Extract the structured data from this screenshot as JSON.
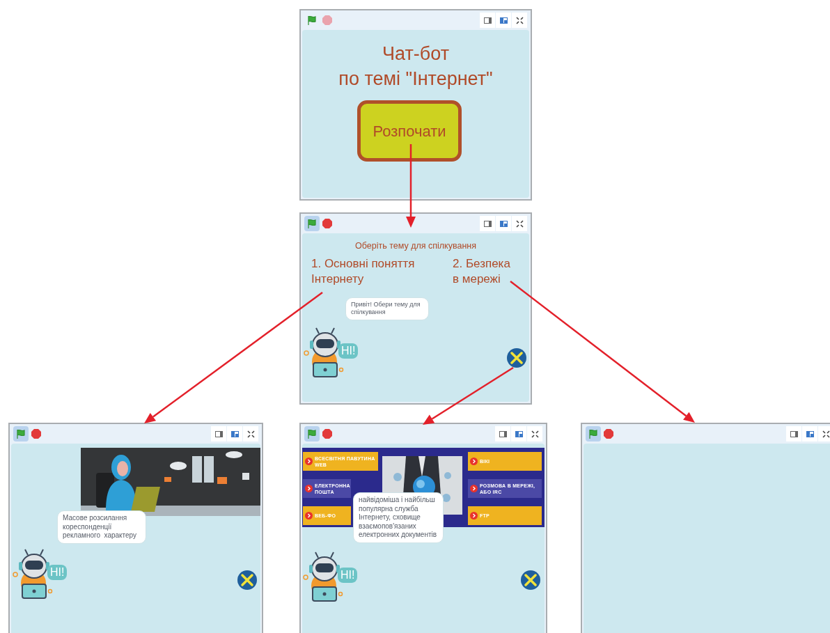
{
  "stages": [
    {
      "kind": "title",
      "running": false,
      "title": "Чат-бот\nпо темі \"Інтернет\"",
      "button": "Розпочати"
    },
    {
      "kind": "menu",
      "running": true,
      "heading": "Оберіть тему для спілкування",
      "topics": [
        "1. Основні поняття\nІнтернету",
        "2. Безпека\nв мережі"
      ],
      "speech": "Привіт! Обери тему для спілкування",
      "robot_greeting": "HI!"
    },
    {
      "kind": "picture_topic",
      "running": true,
      "speech": "Масове розсилання кореспонденції рекламного  характеру",
      "robot_greeting": "HI!"
    },
    {
      "kind": "services",
      "running": true,
      "services": [
        {
          "label": "ВСЕСВІТНЯ ПАВУТИНА WEB",
          "color": "#efb320"
        },
        {
          "label": "ЕЛЕКТРОННА ПОШТА",
          "color": "#4b49a6"
        },
        {
          "label": "ВЕБ-ФО",
          "color": "#efb320"
        },
        {
          "label": "ВІКІ",
          "color": "#efb320"
        },
        {
          "label": "РОЗМОВА В МЕРЕЖІ, АБО IRC",
          "color": "#4b49a6"
        },
        {
          "label": "FTP",
          "color": "#efb320"
        }
      ],
      "speech": "найвідоміша і найбільш популярна служба Інтернету, сховище взаємопов'язаних електронних документів",
      "robot_greeting": "HI!"
    },
    {
      "kind": "empty",
      "running": true
    }
  ]
}
